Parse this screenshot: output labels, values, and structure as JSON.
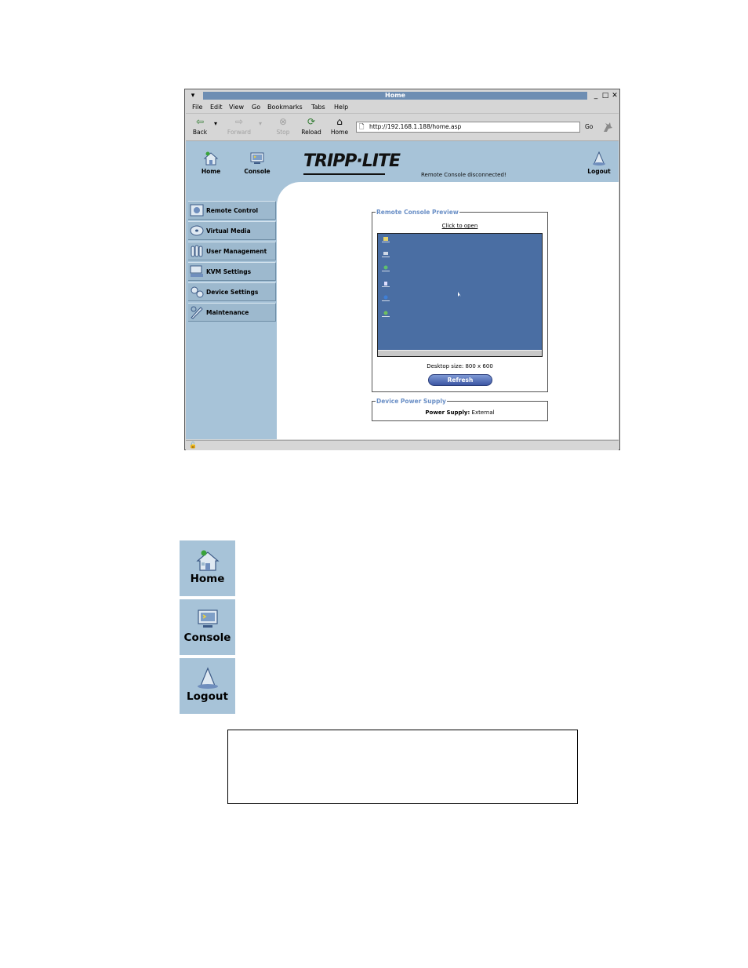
{
  "window": {
    "title": "Home",
    "menu": [
      "File",
      "Edit",
      "View",
      "Go",
      "Bookmarks",
      "Tabs",
      "Help"
    ],
    "toolbar": {
      "back": "Back",
      "forward": "Forward",
      "stop": "Stop",
      "reload": "Reload",
      "home": "Home",
      "url": "http://192.168.1.188/home.asp",
      "go": "Go"
    }
  },
  "header": {
    "home_label": "Home",
    "console_label": "Console",
    "logo_text": "TRIPP·LITE",
    "status": "Remote Console disconnected!",
    "logout_label": "Logout"
  },
  "sidebar": {
    "items": [
      {
        "label": "Remote Control",
        "icon": "remote-control-icon"
      },
      {
        "label": "Virtual Media",
        "icon": "virtual-media-icon"
      },
      {
        "label": "User Management",
        "icon": "user-management-icon"
      },
      {
        "label": "KVM Settings",
        "icon": "kvm-settings-icon"
      },
      {
        "label": "Device Settings",
        "icon": "device-settings-icon"
      },
      {
        "label": "Maintenance",
        "icon": "maintenance-icon"
      }
    ]
  },
  "preview": {
    "legend": "Remote Console Preview",
    "click_to_open": "Click to open",
    "desktop_size": "Desktop size: 800 x 600",
    "refresh_label": "Refresh"
  },
  "power": {
    "legend": "Device Power Supply",
    "label": "Power Supply:",
    "value": "External"
  },
  "big_buttons": {
    "home": "Home",
    "console": "Console",
    "logout": "Logout"
  },
  "colors": {
    "panel_blue": "#a7c3d8",
    "legend_blue": "#6a8fc6",
    "title_blue": "#6e8eb3",
    "desktop_blue": "#4a6ea3"
  }
}
